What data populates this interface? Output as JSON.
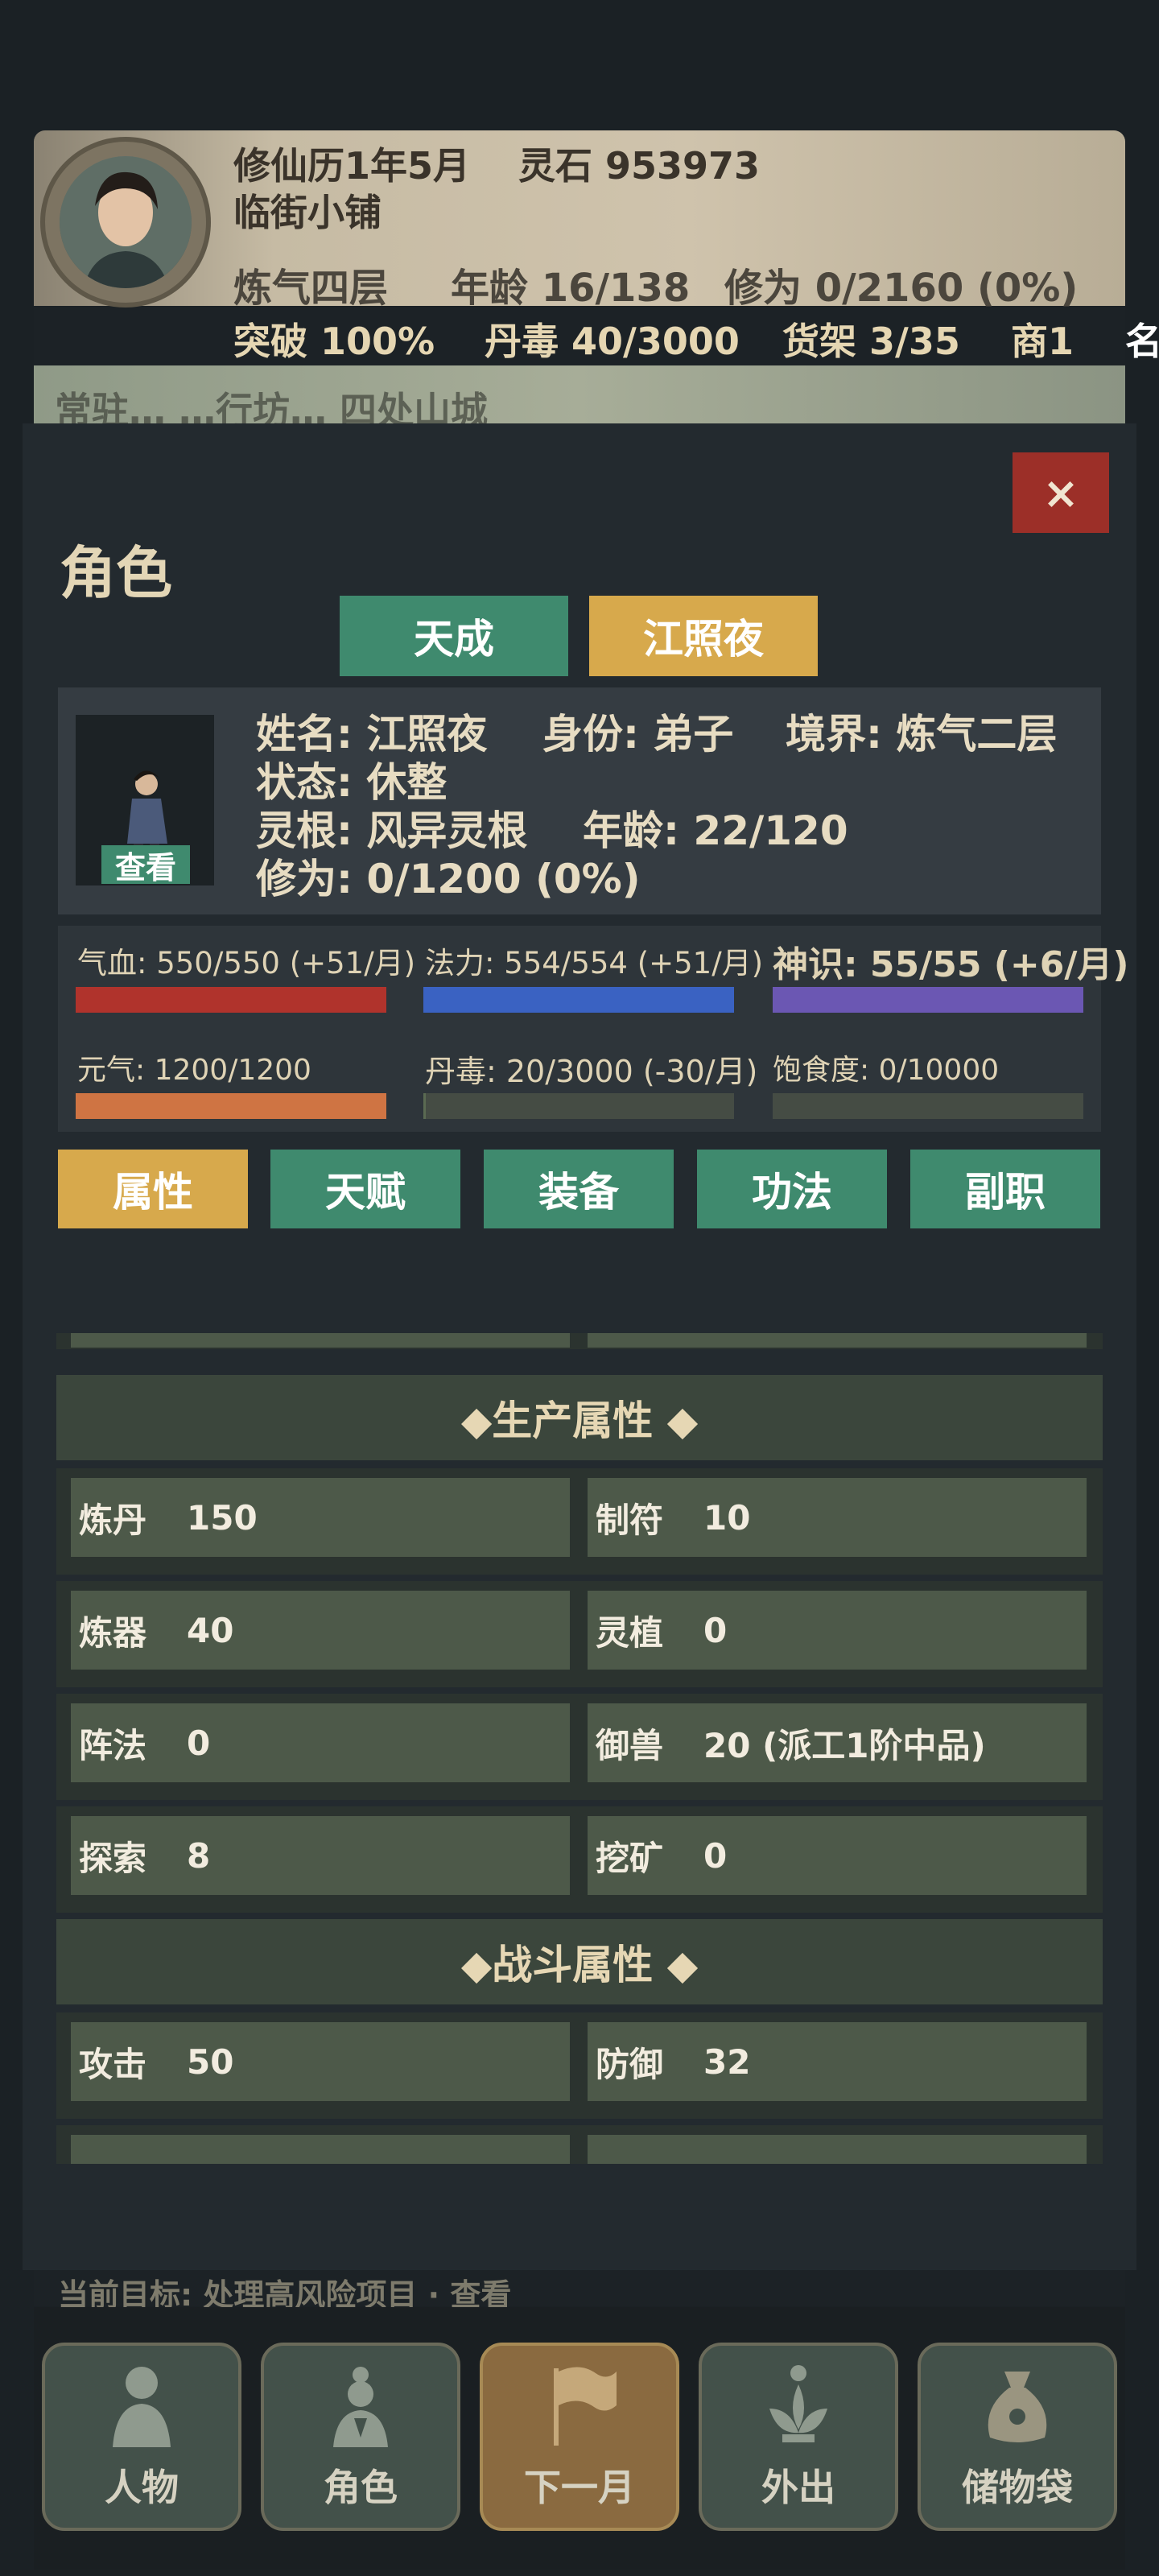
{
  "header": {
    "calendar": "修仙历1年5月",
    "spirit_stones": "灵石 953973",
    "shop": "临街小铺",
    "realm": "炼气四层",
    "age": "年龄 16/138",
    "cultivation": "修为 0/2160 (0%)",
    "breakthrough": "突破 100%",
    "pill_toxicity": "丹毒 40/3000",
    "shelves": "货架 3/35",
    "merchant": "商1",
    "overflow": "名"
  },
  "map_strip": {
    "text": "常驻…  …行坊…  四处山城"
  },
  "modal": {
    "close_label": "×",
    "title": "角色",
    "tabs": [
      {
        "label": "天成",
        "active": false
      },
      {
        "label": "江照夜",
        "active": true
      }
    ],
    "character": {
      "name": "姓名: 江照夜",
      "identity": "身份: 弟子",
      "realm": "境界: 炼气二层",
      "status": "状态: 休整",
      "root": "灵根: 风异灵根",
      "age": "年龄: 22/120",
      "cultivation": "修为: 0/1200 (0%)",
      "view_label": "查看"
    },
    "stats": [
      {
        "label": "气血: 550/550 (+51/月)",
        "fraction": 1.0,
        "color": "#b0332c"
      },
      {
        "label": "法力: 554/554 (+51/月)",
        "fraction": 1.0,
        "color": "#3a62c2"
      },
      {
        "label": "神识: 55/55 (+6/月)",
        "fraction": 1.0,
        "color": "#6b57b3"
      },
      {
        "label": "元气: 1200/1200",
        "fraction": 1.0,
        "color": "#cf7443"
      },
      {
        "label": "丹毒: 20/3000 (-30/月)",
        "fraction": 0.0067,
        "color": "#5a6a52"
      },
      {
        "label": "饱食度: 0/10000",
        "fraction": 0.0,
        "color": "#5a6a52"
      }
    ],
    "subtabs": [
      {
        "label": "属性",
        "active": true
      },
      {
        "label": "天赋",
        "active": false
      },
      {
        "label": "装备",
        "active": false
      },
      {
        "label": "功法",
        "active": false
      },
      {
        "label": "副职",
        "active": false
      }
    ],
    "production_header": "◆生产属性 ◆",
    "production": [
      [
        {
          "k": "炼丹",
          "v": "150"
        },
        {
          "k": "制符",
          "v": "10"
        }
      ],
      [
        {
          "k": "炼器",
          "v": "40"
        },
        {
          "k": "灵植",
          "v": "0"
        }
      ],
      [
        {
          "k": "阵法",
          "v": "0"
        },
        {
          "k": "御兽",
          "v": "20 (派工1阶中品)"
        }
      ],
      [
        {
          "k": "探索",
          "v": "8"
        },
        {
          "k": "挖矿",
          "v": "0"
        }
      ]
    ],
    "combat_header": "◆战斗属性 ◆",
    "combat": [
      [
        {
          "k": "攻击",
          "v": "50"
        },
        {
          "k": "防御",
          "v": "32"
        }
      ]
    ]
  },
  "bottom_strip": {
    "text": "当前目标: 处理高风险项目 · 查看"
  },
  "nav": [
    {
      "label": "人物",
      "icon": "person-icon",
      "active": false
    },
    {
      "label": "角色",
      "icon": "character-icon",
      "active": false
    },
    {
      "label": "下一月",
      "icon": "flag-icon",
      "active": true
    },
    {
      "label": "外出",
      "icon": "lotus-icon",
      "active": false
    },
    {
      "label": "储物袋",
      "icon": "bag-icon",
      "active": false
    }
  ]
}
